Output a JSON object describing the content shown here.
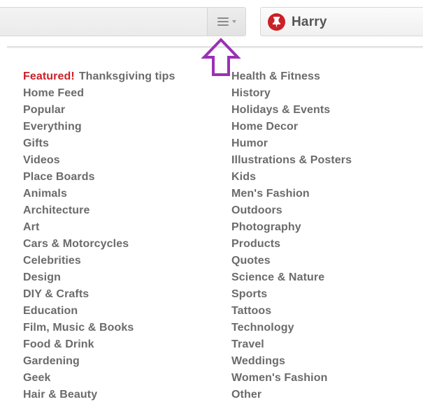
{
  "header": {
    "user_name": "Harry",
    "icons": {
      "menu": "hamburger-menu-icon",
      "caret": "chevron-down-icon",
      "pin": "pinterest-pin-icon",
      "annotation": "up-arrow-icon"
    },
    "colors": {
      "brand_red": "#cb2027",
      "annotation_purple": "#9b30b6",
      "text_gray": "#6b6b6b"
    }
  },
  "menu": {
    "featured_label": "Featured!",
    "featured_text": "Thanksgiving tips",
    "left_items": [
      "Home Feed",
      "Popular",
      "Everything",
      "Gifts",
      "Videos",
      "Place Boards",
      "Animals",
      "Architecture",
      "Art",
      "Cars & Motorcycles",
      "Celebrities",
      "Design",
      "DIY & Crafts",
      "Education",
      "Film, Music & Books",
      "Food & Drink",
      "Gardening",
      "Geek",
      "Hair & Beauty"
    ],
    "right_items": [
      "Health & Fitness",
      "History",
      "Holidays & Events",
      "Home Decor",
      "Humor",
      "Illustrations & Posters",
      "Kids",
      "Men's Fashion",
      "Outdoors",
      "Photography",
      "Products",
      "Quotes",
      "Science & Nature",
      "Sports",
      "Tattoos",
      "Technology",
      "Travel",
      "Weddings",
      "Women's Fashion",
      "Other"
    ]
  }
}
